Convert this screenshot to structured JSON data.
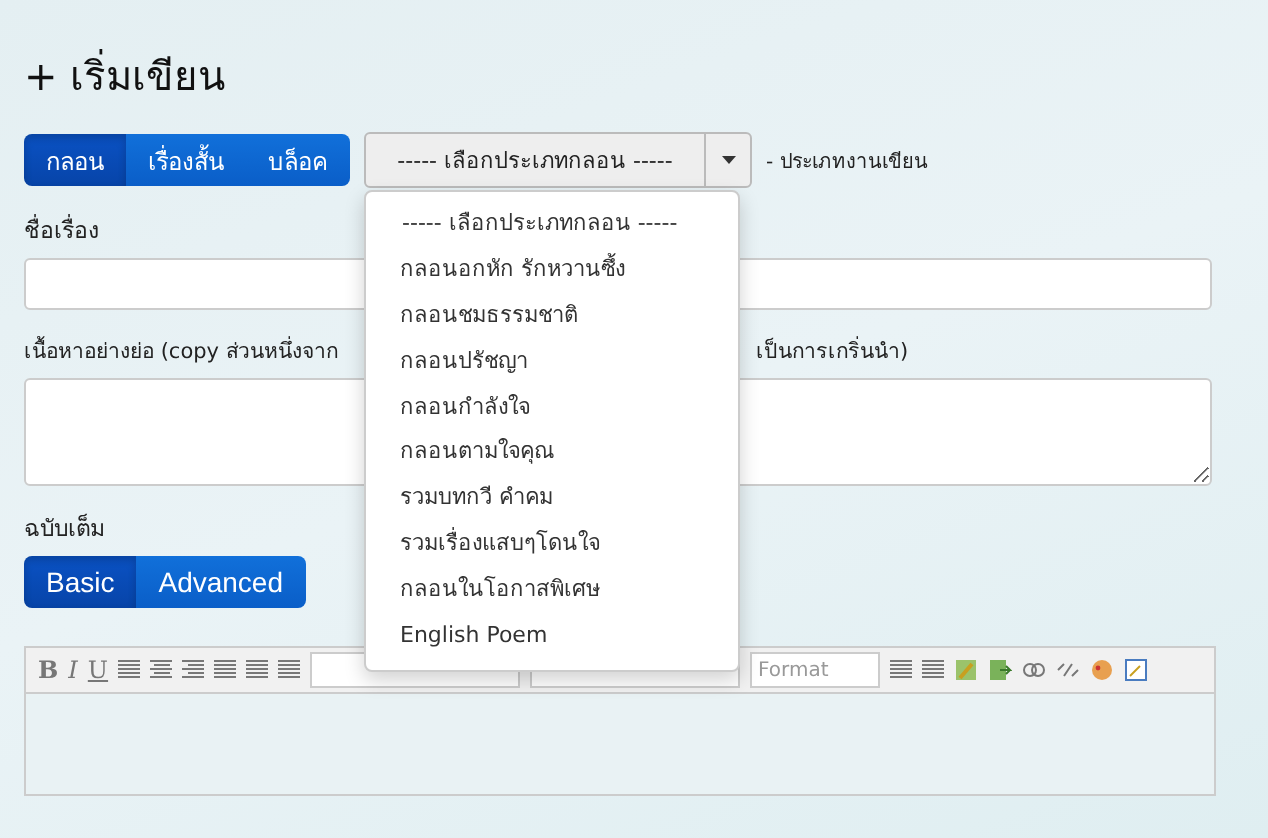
{
  "page_title": "+ เริ่มเขียน",
  "type_tabs": [
    {
      "label": "กลอน",
      "selected": true
    },
    {
      "label": "เรื่องสั้น",
      "selected": false
    },
    {
      "label": "บล็อค",
      "selected": false
    }
  ],
  "type_select": {
    "value": "----- เลือกประเภทกลอน -----",
    "expanded": true,
    "hint": "- ประเภทงานเขียน",
    "options": [
      {
        "label": "----- เลือกประเภทกลอน -----"
      },
      {
        "label": "กลอนอกหัก รักหวานซึ้ง"
      },
      {
        "label": "กลอนชมธรรมชาติ"
      },
      {
        "label": "กลอนปรัชญา"
      },
      {
        "label": "กลอนกำลังใจ"
      },
      {
        "label": "กลอนตามใจคุณ"
      },
      {
        "label": "รวมบทกวี คำคม"
      },
      {
        "label": "รวมเรื่องแสบๆโดนใจ"
      },
      {
        "label": "กลอนในโอกาสพิเศษ"
      },
      {
        "label": "English Poem"
      }
    ]
  },
  "title_field": {
    "label": "ชื่อเรื่อง"
  },
  "abstract_field": {
    "label_start": "เนื้อหาอย่างย่อ (copy ส่วนหนึ่งจาก",
    "label_end": "เป็นการเกริ่นนำ)"
  },
  "full_text": {
    "label": "ฉบับเต็ม",
    "modes": [
      {
        "label": "Basic",
        "selected": true
      },
      {
        "label": "Advanced",
        "selected": false
      }
    ]
  },
  "editor_toolbar": {
    "format_buttons": [
      "B",
      "I",
      "U"
    ],
    "format_select": "Format"
  }
}
